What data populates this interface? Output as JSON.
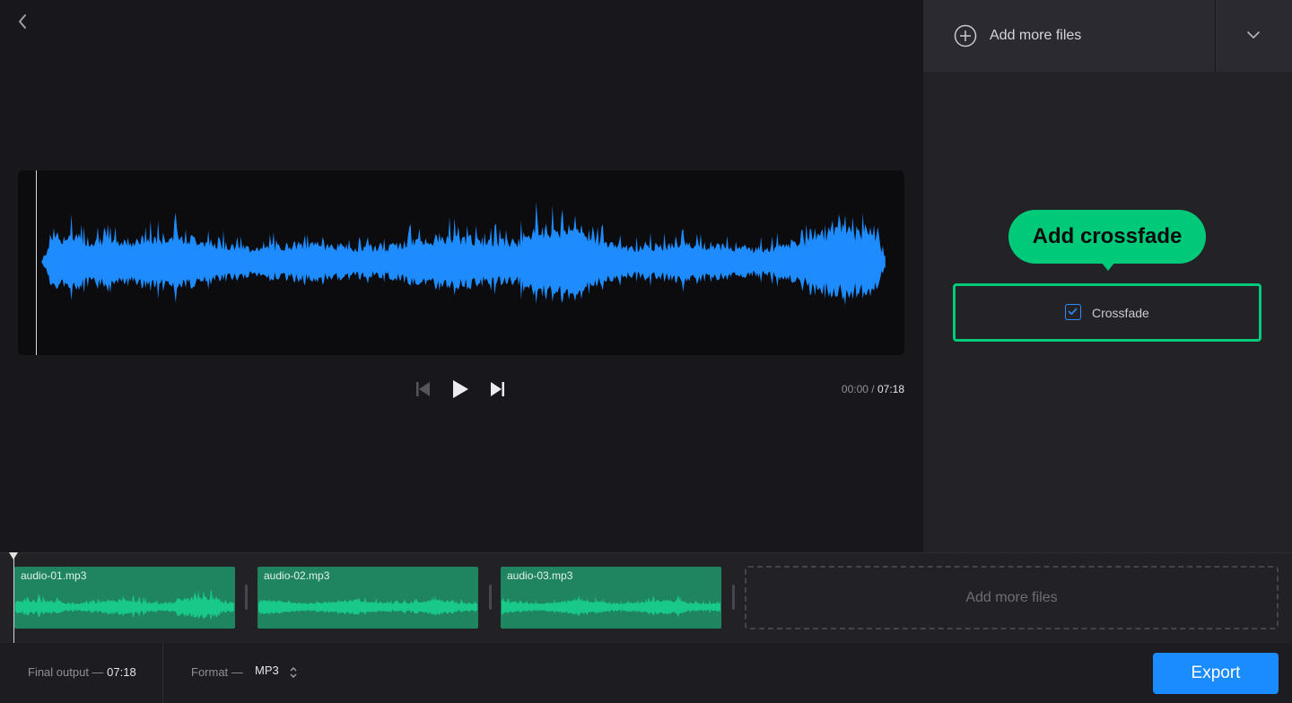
{
  "player": {
    "current_time": "00:00",
    "separator": "/",
    "total_time": "07:18"
  },
  "sidebar": {
    "add_files_label": "Add more files",
    "tooltip": "Add crossfade",
    "crossfade_label": "Crossfade",
    "crossfade_checked": true
  },
  "timeline": {
    "clips": [
      {
        "name": "audio-01.mp3"
      },
      {
        "name": "audio-02.mp3"
      },
      {
        "name": "audio-03.mp3"
      }
    ],
    "add_label": "Add more files"
  },
  "footer": {
    "final_output_label": "Final output —",
    "final_output_value": "07:18",
    "format_label": "Format —",
    "format_value": "MP3",
    "export_label": "Export"
  },
  "colors": {
    "waveform": "#1e8cff",
    "accent_green": "#00c97a",
    "clip_wave": "#19c98a",
    "export_blue": "#1a8cff"
  },
  "icons": [
    "back-chevron-icon",
    "skip-back-icon",
    "play-icon",
    "skip-forward-icon",
    "plus-circle-icon",
    "chevron-down-icon",
    "check-icon",
    "sort-arrows-icon"
  ]
}
